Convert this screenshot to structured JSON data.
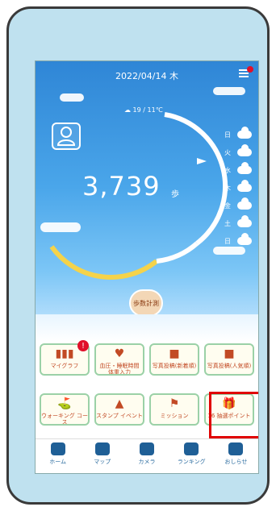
{
  "header": {
    "date": "2022/04/14 木"
  },
  "weather": {
    "current": "19 / 11℃",
    "forecast": [
      {
        "day": "日"
      },
      {
        "day": "火"
      },
      {
        "day": "水"
      },
      {
        "day": "木"
      },
      {
        "day": "金"
      },
      {
        "day": "土"
      },
      {
        "day": "日"
      }
    ]
  },
  "steps": {
    "count": "3,739",
    "unit": "歩"
  },
  "button": {
    "sanpo": "歩数計測"
  },
  "tiles": [
    {
      "label": "マイグラフ",
      "icon": "chart-icon"
    },
    {
      "label": "血圧・睡眠時間\n体重入力",
      "icon": "heart-icon"
    },
    {
      "label": "写真投稿(新着順)",
      "icon": "photo-icon"
    },
    {
      "label": "写真投稿(人気順)",
      "icon": "photo-icon"
    },
    {
      "label": "ウォーキング\nコース",
      "icon": "route-icon"
    },
    {
      "label": "スタンプ\nイベント",
      "icon": "stamp-icon"
    },
    {
      "label": "ミッション",
      "icon": "mission-icon"
    },
    {
      "label": "16\n抽選ポイント",
      "icon": "gift-icon"
    }
  ],
  "badge": "!",
  "nav": [
    {
      "label": "ホーム"
    },
    {
      "label": "マップ"
    },
    {
      "label": "カメラ"
    },
    {
      "label": "ランキング"
    },
    {
      "label": "おしらせ"
    }
  ]
}
